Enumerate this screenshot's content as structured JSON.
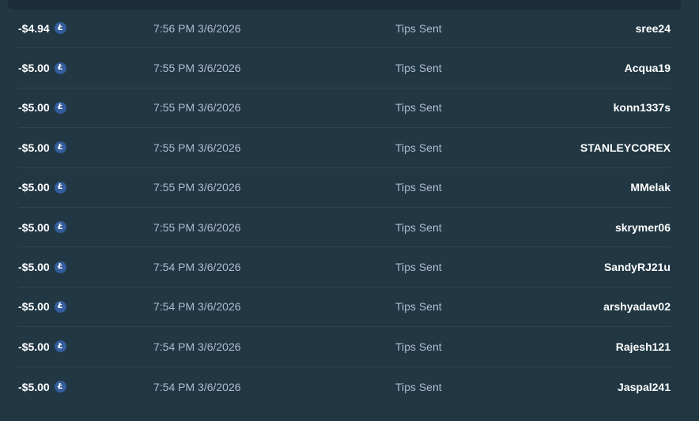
{
  "currency_icon": "litecoin-icon",
  "colors": {
    "background": "#213743",
    "divider": "#2f4553",
    "muted_text": "#b1bad3",
    "litecoin": "#345d9d"
  },
  "rows": [
    {
      "amount": "-$4.94",
      "time": "7:56 PM 3/6/2026",
      "type": "Tips Sent",
      "user": "sree24"
    },
    {
      "amount": "-$5.00",
      "time": "7:55 PM 3/6/2026",
      "type": "Tips Sent",
      "user": "Acqua19"
    },
    {
      "amount": "-$5.00",
      "time": "7:55 PM 3/6/2026",
      "type": "Tips Sent",
      "user": "konn1337s"
    },
    {
      "amount": "-$5.00",
      "time": "7:55 PM 3/6/2026",
      "type": "Tips Sent",
      "user": "STANLEYCOREX"
    },
    {
      "amount": "-$5.00",
      "time": "7:55 PM 3/6/2026",
      "type": "Tips Sent",
      "user": "MMelak"
    },
    {
      "amount": "-$5.00",
      "time": "7:55 PM 3/6/2026",
      "type": "Tips Sent",
      "user": "skrymer06"
    },
    {
      "amount": "-$5.00",
      "time": "7:54 PM 3/6/2026",
      "type": "Tips Sent",
      "user": "SandyRJ21u"
    },
    {
      "amount": "-$5.00",
      "time": "7:54 PM 3/6/2026",
      "type": "Tips Sent",
      "user": "arshyadav02"
    },
    {
      "amount": "-$5.00",
      "time": "7:54 PM 3/6/2026",
      "type": "Tips Sent",
      "user": "Rajesh121"
    },
    {
      "amount": "-$5.00",
      "time": "7:54 PM 3/6/2026",
      "type": "Tips Sent",
      "user": "Jaspal241"
    }
  ]
}
